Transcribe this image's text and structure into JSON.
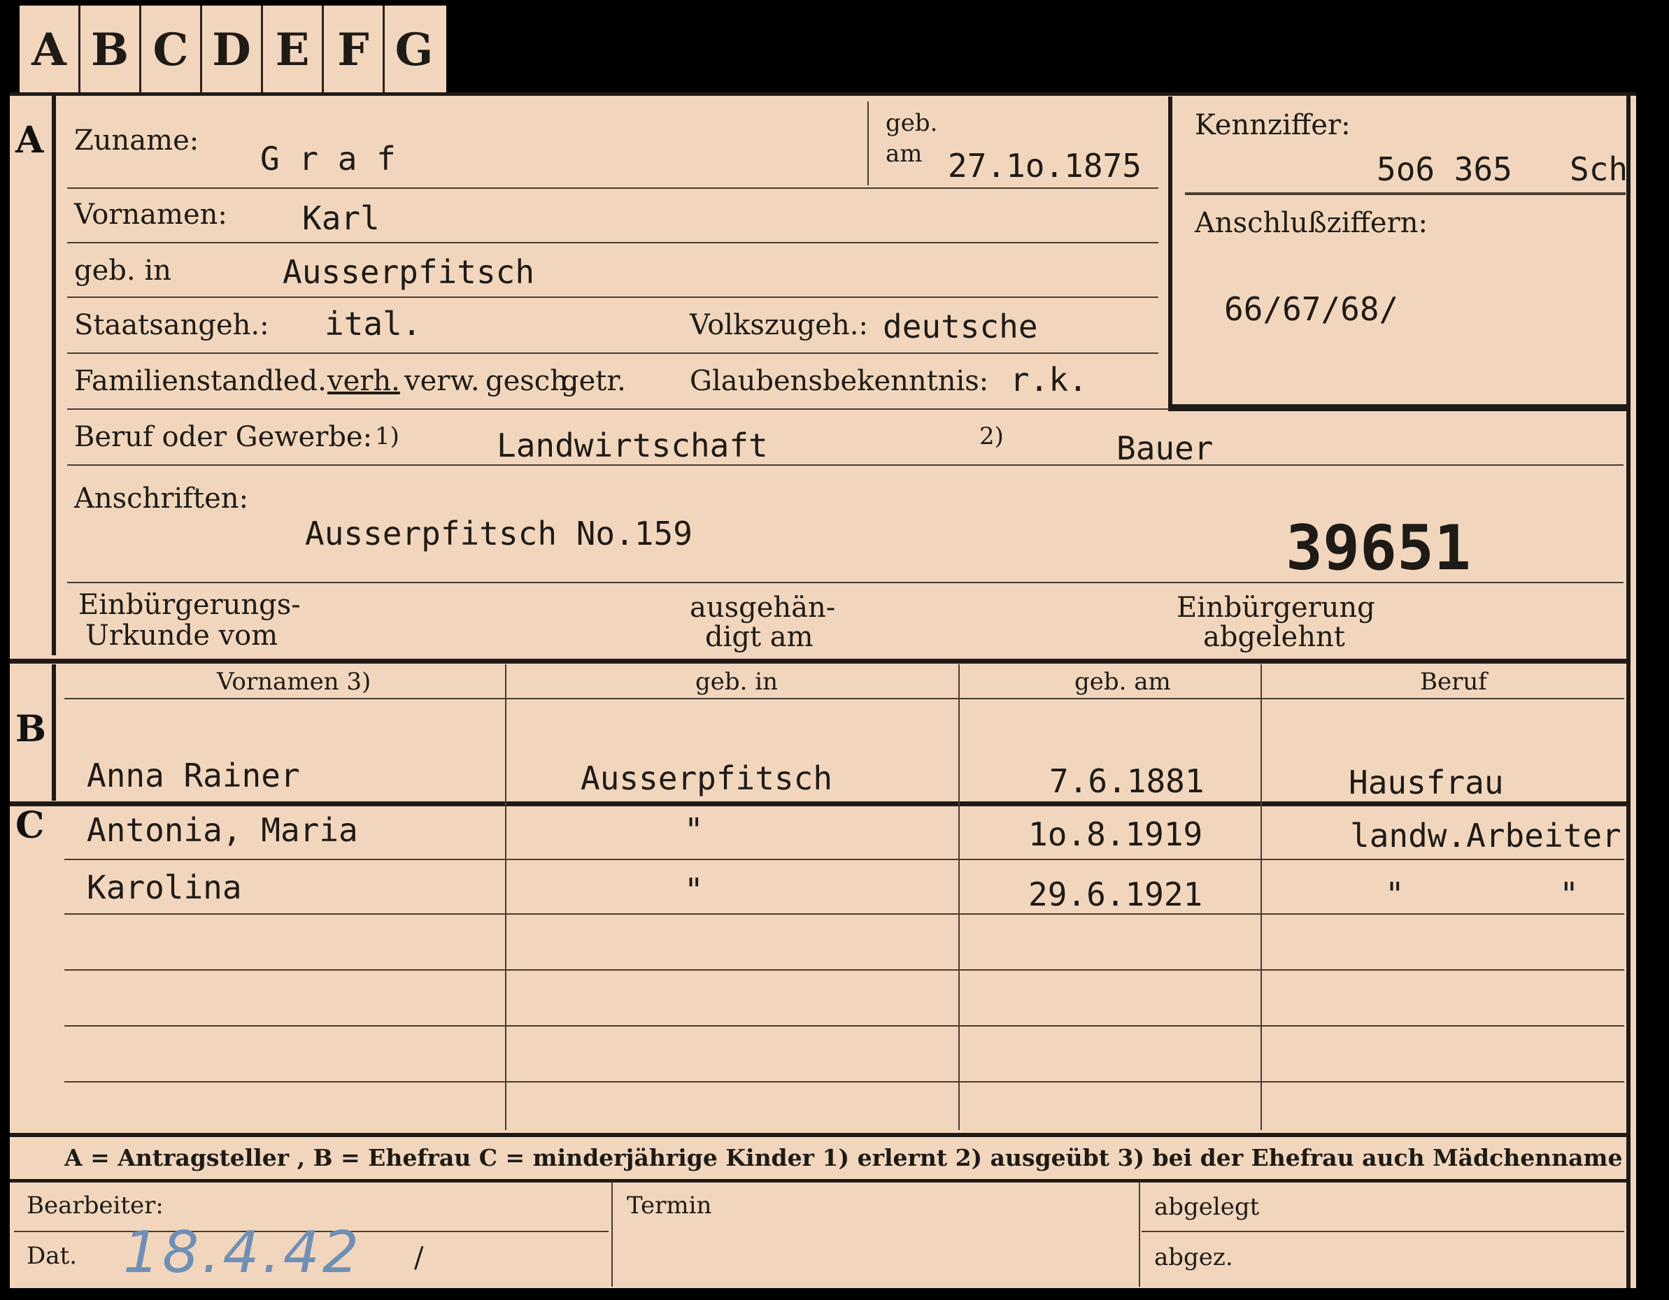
{
  "index_tabs": [
    "A",
    "B",
    "C",
    "D",
    "E",
    "F",
    "G"
  ],
  "sections": {
    "a": "A",
    "b": "B",
    "c": "C"
  },
  "header": {
    "surname_label": "Zuname:",
    "surname": "G r a f",
    "birth_label_1": "geb.",
    "birth_label_2": "am",
    "birth_date": "27.1o.1875",
    "id_label": "Kennziffer:",
    "id_value": "5o6 365",
    "id_suffix": "Sch",
    "connect_label": "Anschlußziffern:",
    "connect_value": "66/67/68/"
  },
  "person": {
    "given_label": "Vornamen:",
    "given": "Karl",
    "birthplace_label": "geb. in",
    "birthplace": "Ausserpfitsch",
    "citizenship_label": "Staatsangeh.:",
    "citizenship": "ital.",
    "ethnicity_label": "Volkszugeh.:",
    "ethnicity": "deutsche",
    "marital_label": "Familienstand:",
    "marital_options": [
      "led.",
      "verh.",
      "verw.",
      "gesch.",
      "getr."
    ],
    "marital_selected": "verh.",
    "religion_label": "Glaubensbekenntnis:",
    "religion": "r.k.",
    "profession_label": "Beruf oder Gewerbe:",
    "profession_note_1": "1)",
    "profession_learned": "Landwirtschaft",
    "profession_note_2": "2)",
    "profession_practised": "Bauer",
    "address_label": "Anschriften:",
    "address": "Ausserpfitsch  No.159",
    "file_number": "39651",
    "naturalization_label_1": "Einbürgerungs-",
    "naturalization_label_2": "Urkunde vom",
    "handed_label_1": "ausgehän-",
    "handed_label_2": "digt am",
    "rejected_label_1": "Einbürgerung",
    "rejected_label_2": "abgelehnt"
  },
  "family_table": {
    "headers": [
      "Vornamen 3)",
      "geb. in",
      "geb. am",
      "Beruf"
    ],
    "spouse": {
      "name": "Anna   Rainer",
      "birthplace": "Ausserpfitsch",
      "birth_date": "7.6.1881",
      "profession": "Hausfrau"
    },
    "children": [
      {
        "name": "Antonia, Maria",
        "birthplace": "\"",
        "birth_date": "1o.8.1919",
        "profession": "landw.Arbeiter"
      },
      {
        "name": "Karolina",
        "birthplace": "\"",
        "birth_date": "29.6.1921",
        "profession": "\"        \""
      }
    ]
  },
  "legend": "A = Antragsteller , B = Ehefrau   C = minderjährige Kinder   1) erlernt   2) ausgeübt   3) bei der Ehefrau auch Mädchenname",
  "footer": {
    "clerk_label": "Bearbeiter:",
    "date_label": "Dat.",
    "date_value": "18.4.42",
    "date_slash": "/",
    "deadline_label": "Termin",
    "filed_label": "abgelegt",
    "signed_label": "abgez."
  }
}
